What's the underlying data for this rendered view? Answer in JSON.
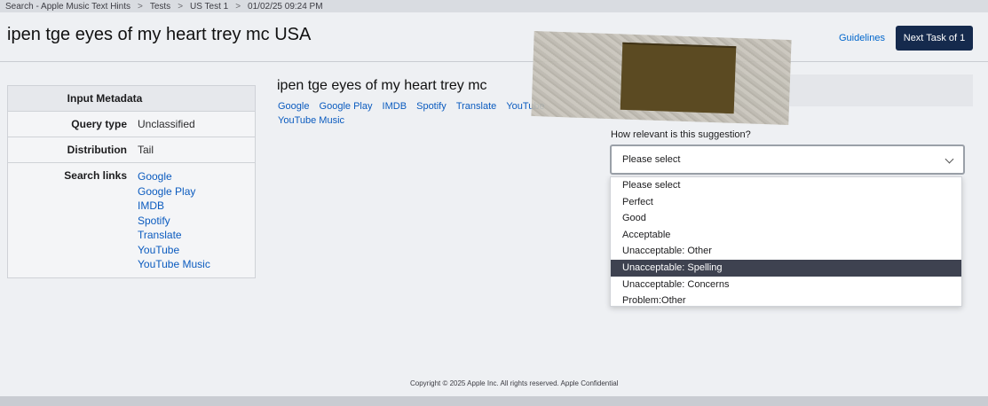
{
  "breadcrumb": [
    "Search - Apple Music Text Hints",
    "Tests",
    "US Test 1",
    "01/02/25 09:24 PM"
  ],
  "header": {
    "title": "ipen tge eyes of my heart trey mc USA",
    "guidelines_label": "Guidelines",
    "next_task_label": "Next Task of 1"
  },
  "metadata": {
    "heading": "Input Metadata",
    "query_type_key": "Query type",
    "query_type_value": "Unclassified",
    "distribution_key": "Distribution",
    "distribution_value": "Tail",
    "search_links_key": "Search links",
    "search_links": [
      "Google",
      "Google Play",
      "IMDB",
      "Spotify",
      "Translate",
      "YouTube",
      "YouTube Music"
    ]
  },
  "query": {
    "title": "ipen tge eyes of my heart trey mc",
    "links": [
      "Google",
      "Google Play",
      "IMDB",
      "Spotify",
      "Translate",
      "YouTube",
      "YouTube Music"
    ]
  },
  "question": {
    "label": "How relevant is this suggestion?",
    "select_value": "Please select",
    "options": [
      "Please select",
      "Perfect",
      "Good",
      "Acceptable",
      "Unacceptable: Other",
      "Unacceptable: Spelling",
      "Unacceptable: Concerns",
      "Problem:Other"
    ],
    "highlighted_option": "Unacceptable: Spelling"
  },
  "footer": "Copyright © 2025 Apple Inc. All rights reserved. Apple Confidential"
}
